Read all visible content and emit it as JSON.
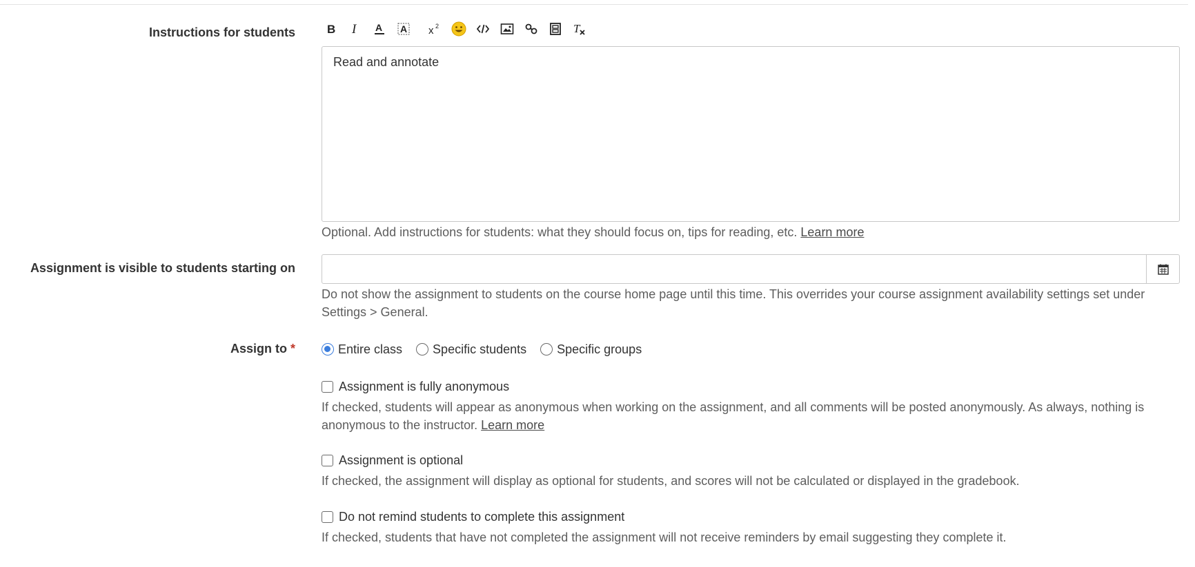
{
  "instructions": {
    "label": "Instructions for students",
    "toolbar": [
      {
        "name": "bold-icon",
        "glyph": "B"
      },
      {
        "name": "italic-icon",
        "glyph": "I"
      },
      {
        "name": "font-color-icon",
        "glyph": "A"
      },
      {
        "name": "highlight-color-icon",
        "glyph": "A"
      },
      {
        "name": "superscript-icon",
        "glyph": "x²"
      },
      {
        "name": "emoji-icon",
        "glyph": "😀"
      },
      {
        "name": "code-icon",
        "glyph": "</>"
      },
      {
        "name": "image-icon",
        "glyph": "image"
      },
      {
        "name": "link-icon",
        "glyph": "link"
      },
      {
        "name": "video-icon",
        "glyph": "film"
      },
      {
        "name": "clear-format-icon",
        "glyph": "Tx"
      }
    ],
    "value": "Read and annotate",
    "help_text": "Optional. Add instructions for students: what they should focus on, tips for reading, etc.",
    "help_link": "Learn more"
  },
  "visibility": {
    "label": "Assignment is visible to students starting on",
    "value": "",
    "icon": "calendar-icon",
    "help_text": "Do not show the assignment to students on the course home page until this time. This overrides your course assignment availability settings set under Settings > General."
  },
  "assign_to": {
    "label": "Assign to",
    "required_mark": "*",
    "options": [
      {
        "label": "Entire class",
        "checked": true
      },
      {
        "label": "Specific students",
        "checked": false
      },
      {
        "label": "Specific groups",
        "checked": false
      }
    ],
    "accent_color": "#3b7ddd"
  },
  "anonymous": {
    "label": "Assignment is fully anonymous",
    "checked": false,
    "help_text": "If checked, students will appear as anonymous when working on the assignment, and all comments will be posted anonymously. As always, nothing is anonymous to the instructor.",
    "help_link": "Learn more"
  },
  "optional": {
    "label": "Assignment is optional",
    "checked": false,
    "help_text": "If checked, the assignment will display as optional for students, and scores will not be calculated or displayed in the gradebook."
  },
  "no_remind": {
    "label": "Do not remind students to complete this assignment",
    "checked": false,
    "help_text": "If checked, students that have not completed the assignment will not receive reminders by email suggesting they complete it."
  }
}
